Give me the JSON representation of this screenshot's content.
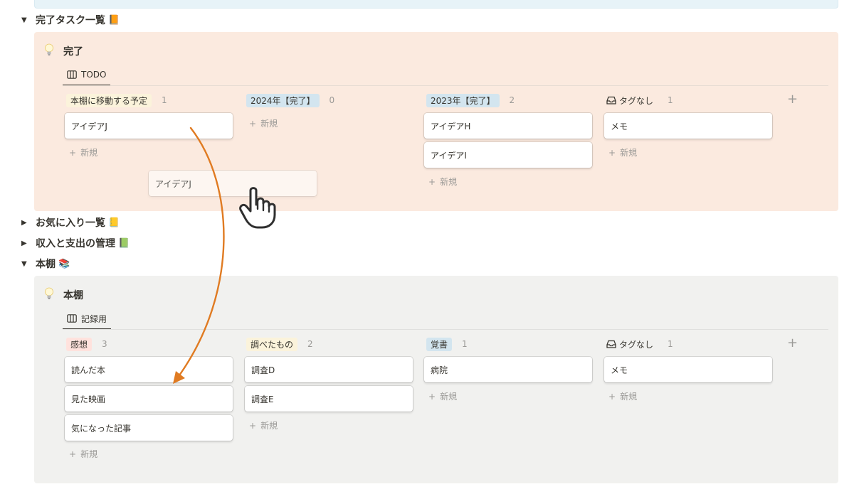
{
  "sections": {
    "completed": {
      "label": "完了タスク一覧",
      "emoji": "📙"
    },
    "favorites": {
      "label": "お気に入り一覧",
      "emoji": "📒"
    },
    "finance": {
      "label": "収入と支出の管理",
      "emoji": "📗"
    },
    "bookshelf": {
      "label": "本棚",
      "emoji": "📚"
    }
  },
  "board1": {
    "title": "完了",
    "tab": "TODO",
    "columns": [
      {
        "name": "本棚に移動する予定",
        "count": "1",
        "cards": [
          "アイデアJ"
        ]
      },
      {
        "name": "2024年【完了】",
        "count": "0",
        "cards": []
      },
      {
        "name": "2023年【完了】",
        "count": "2",
        "cards": [
          "アイデアH",
          "アイデアI"
        ]
      },
      {
        "name": "タグなし",
        "count": "1",
        "cards": [
          "メモ"
        ]
      }
    ],
    "drag_card": "アイデアJ"
  },
  "board2": {
    "title": "本棚",
    "tab": "記録用",
    "columns": [
      {
        "name": "感想",
        "count": "3",
        "cards": [
          "読んだ本",
          "見た映画",
          "気になった記事"
        ]
      },
      {
        "name": "調べたもの",
        "count": "2",
        "cards": [
          "調査D",
          "調査E"
        ]
      },
      {
        "name": "覚書",
        "count": "1",
        "cards": [
          "病院"
        ]
      },
      {
        "name": "タグなし",
        "count": "1",
        "cards": [
          "メモ"
        ]
      }
    ]
  },
  "labels": {
    "new": "新規",
    "add": "+"
  },
  "colors": {
    "arrow": "#e07b22",
    "orange_callout": "#fbeadf",
    "gray_callout": "#f1f1ef",
    "tag_yellow": "#fbf3db",
    "tag_blue": "#d3e5ef",
    "tag_red": "#ffe2dd"
  }
}
